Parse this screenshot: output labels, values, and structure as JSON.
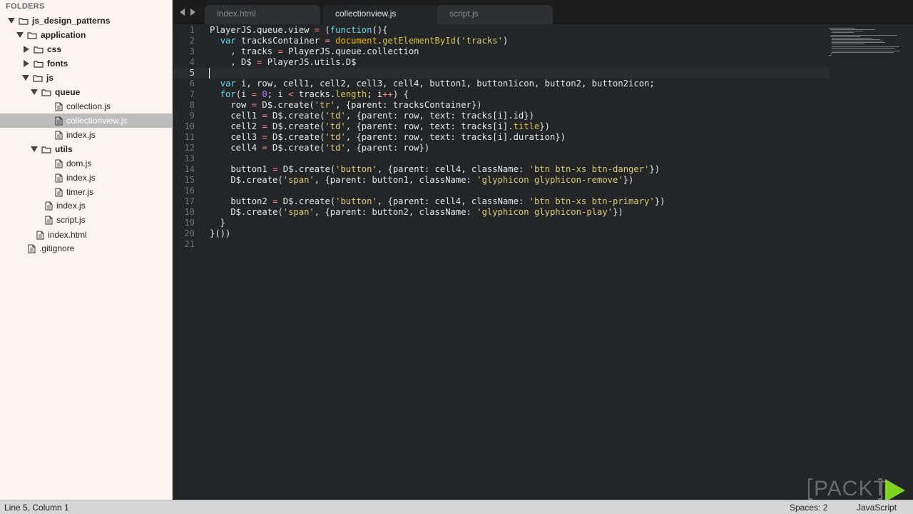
{
  "sidebar": {
    "header": "FOLDERS",
    "tree": [
      {
        "label": "js_design_patterns",
        "type": "folder",
        "expanded": true
      },
      {
        "label": "application",
        "type": "folder",
        "expanded": true
      },
      {
        "label": "css",
        "type": "folder",
        "expanded": false
      },
      {
        "label": "fonts",
        "type": "folder",
        "expanded": false
      },
      {
        "label": "js",
        "type": "folder",
        "expanded": true
      },
      {
        "label": "queue",
        "type": "folder",
        "expanded": true
      },
      {
        "label": "collection.js",
        "type": "file"
      },
      {
        "label": "collectionview.js",
        "type": "file",
        "selected": true
      },
      {
        "label": "index.js",
        "type": "file"
      },
      {
        "label": "utils",
        "type": "folder",
        "expanded": true
      },
      {
        "label": "dom.js",
        "type": "file"
      },
      {
        "label": "index.js",
        "type": "file"
      },
      {
        "label": "timer.js",
        "type": "file"
      },
      {
        "label": "index.js",
        "type": "file"
      },
      {
        "label": "script.js",
        "type": "file"
      },
      {
        "label": "index.html",
        "type": "file"
      },
      {
        "label": ".gitignore",
        "type": "file"
      }
    ]
  },
  "tabs": [
    {
      "label": "index.html",
      "active": false
    },
    {
      "label": "collectionview.js",
      "active": true
    },
    {
      "label": "script.js",
      "active": false
    }
  ],
  "editor": {
    "current_line": 5,
    "lines": [
      "PlayerJS.queue.view = (function(){",
      "  var tracksContainer = document.getElementById('tracks')",
      "    , tracks = PlayerJS.queue.collection",
      "    , D$ = PlayerJS.utils.D$",
      "",
      "  var i, row, cell1, cell2, cell3, cell4, button1, button1icon, button2, button2icon;",
      "  for(i = 0; i < tracks.length; i++) {",
      "    row = D$.create('tr', {parent: tracksContainer})",
      "    cell1 = D$.create('td', {parent: row, text: tracks[i].id})",
      "    cell2 = D$.create('td', {parent: row, text: tracks[i].title})",
      "    cell3 = D$.create('td', {parent: row, text: tracks[i].duration})",
      "    cell4 = D$.create('td', {parent: row})",
      "",
      "    button1 = D$.create('button', {parent: cell4, className: 'btn btn-xs btn-danger'})",
      "    D$.create('span', {parent: button1, className: 'glyphicon glyphicon-remove'})",
      "",
      "    button2 = D$.create('button', {parent: cell4, className: 'btn btn-xs btn-primary'})",
      "    D$.create('span', {parent: button2, className: 'glyphicon glyphicon-play'})",
      "  }",
      "}())",
      ""
    ]
  },
  "statusbar": {
    "position": "Line 5, Column 1",
    "spaces": "Spaces: 2",
    "syntax": "JavaScript"
  },
  "watermark": {
    "text": "PACKT"
  },
  "colors": {
    "sidebar_bg": "#fdf4f2",
    "editor_bg": "#232526",
    "keyword": "#66d9ef",
    "string": "#dacb7a",
    "number": "#ae81ff",
    "brand_green": "#7ed321"
  }
}
